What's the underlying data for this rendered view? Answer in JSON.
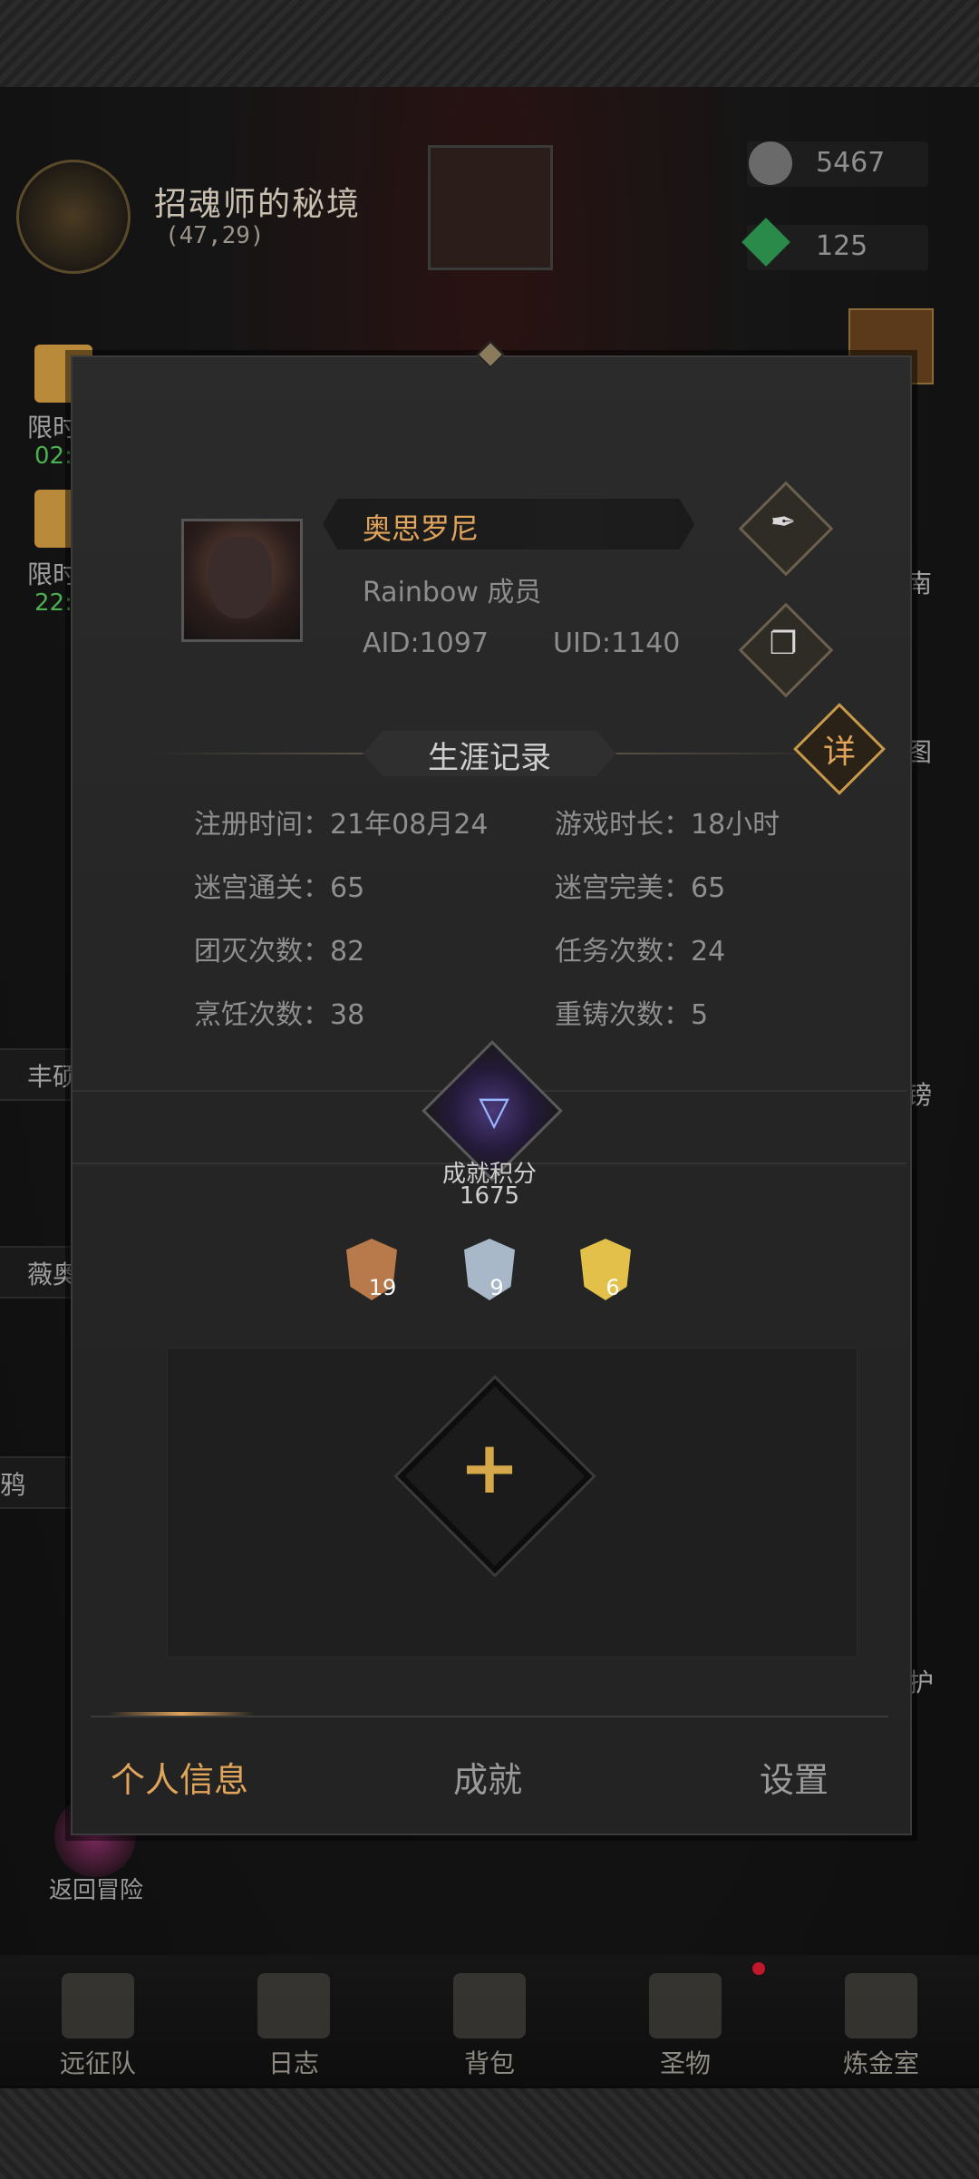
{
  "location": {
    "name": "招魂师的秘境",
    "coords": "(47,29)"
  },
  "resources": [
    {
      "icon": "stone-icon",
      "value": "5467"
    },
    {
      "icon": "emerald-icon",
      "value": "125"
    }
  ],
  "side_left": [
    {
      "label": "限时",
      "timer": "02:"
    },
    {
      "label": "限时",
      "timer": "22:"
    }
  ],
  "side_tabs": [
    "丰硕",
    "薇奥",
    "鸦"
  ],
  "side_right_fragments": [
    "南",
    "图",
    "镑",
    "护"
  ],
  "profile": {
    "name": "奥思罗尼",
    "guild": "Rainbow 成员",
    "aid": "AID:1097",
    "uid": "UID:1140"
  },
  "career": {
    "title": "生涯记录",
    "detail_label": "详",
    "stats": [
      {
        "label": "注册时间：21年08月24"
      },
      {
        "label": "游戏时长：18小时"
      },
      {
        "label": "迷宫通关：65"
      },
      {
        "label": "迷宫完美：65"
      },
      {
        "label": "团灭次数：82"
      },
      {
        "label": "任务次数：24"
      },
      {
        "label": "烹饪次数：38"
      },
      {
        "label": "重铸次数：5"
      }
    ]
  },
  "achievement": {
    "label": "成就积分",
    "score": "1675",
    "medals": [
      {
        "name": "bronze",
        "count": "19",
        "color": "#b87a4a"
      },
      {
        "name": "silver",
        "count": "9",
        "color": "#a9b8c8"
      },
      {
        "name": "gold",
        "count": "6",
        "color": "#e2c04a"
      }
    ]
  },
  "tabs": [
    {
      "label": "个人信息",
      "active": true
    },
    {
      "label": "成就",
      "active": false
    },
    {
      "label": "设置",
      "active": false
    }
  ],
  "return_label": "返回冒险",
  "bottom_nav": [
    {
      "label": "远征队",
      "icon": "helmet-icon"
    },
    {
      "label": "日志",
      "icon": "scroll-icon"
    },
    {
      "label": "背包",
      "icon": "backpack-icon"
    },
    {
      "label": "圣物",
      "icon": "chalice-icon"
    },
    {
      "label": "炼金室",
      "icon": "alchemy-icon"
    }
  ],
  "colors": {
    "accent": "#e0a45a",
    "timer_green": "#4caf50"
  }
}
